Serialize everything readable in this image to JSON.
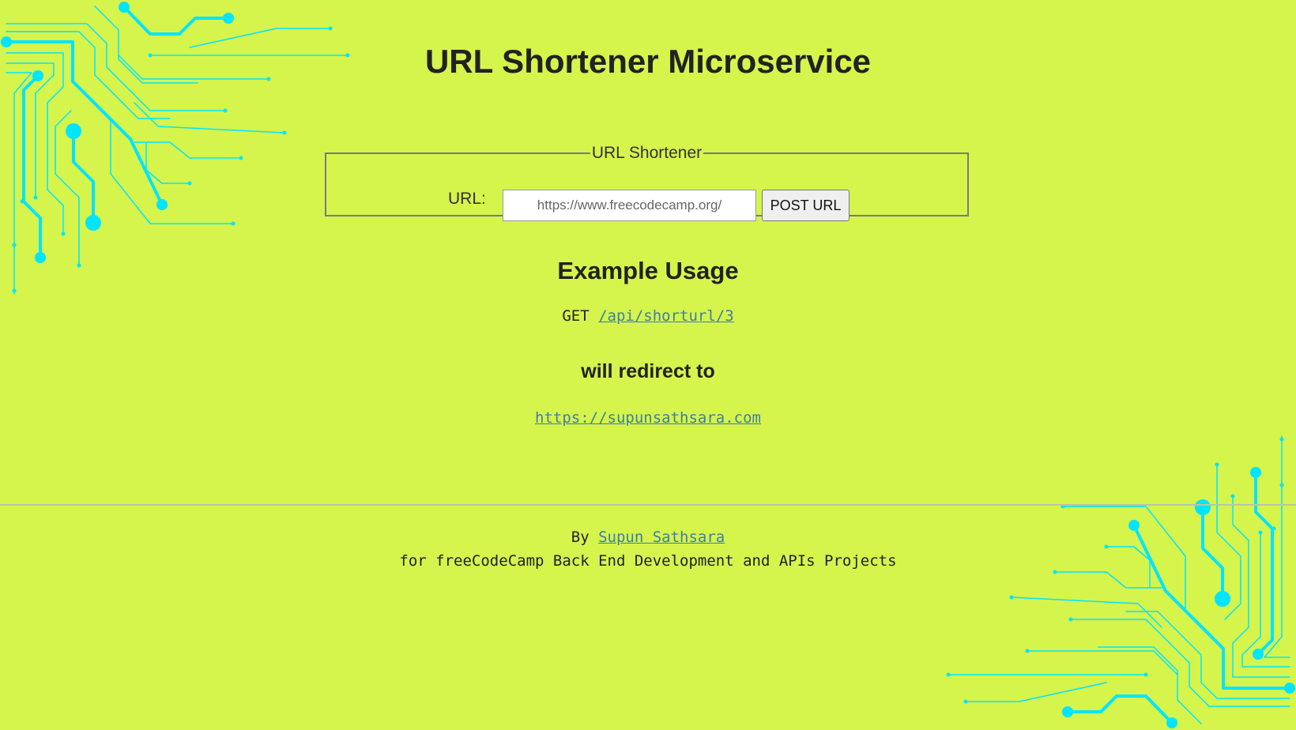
{
  "page": {
    "title": "URL Shortener Microservice"
  },
  "form": {
    "legend": "URL Shortener",
    "url_label": "URL:",
    "url_placeholder": "https://www.freecodecamp.org/",
    "submit_label": "POST URL"
  },
  "example": {
    "heading": "Example Usage",
    "method": "GET",
    "path": "/api/shorturl/3",
    "redirect_heading": "will redirect to",
    "redirect_url": "https://supunsathsara.com"
  },
  "footer": {
    "by_label": "By",
    "author": "Supun Sathsara",
    "tagline": "for freeCodeCamp Back End Development and APIs Projects"
  },
  "colors": {
    "background": "#d5f44c",
    "circuit": "#00e5ff",
    "link": "#3d7fa3"
  }
}
